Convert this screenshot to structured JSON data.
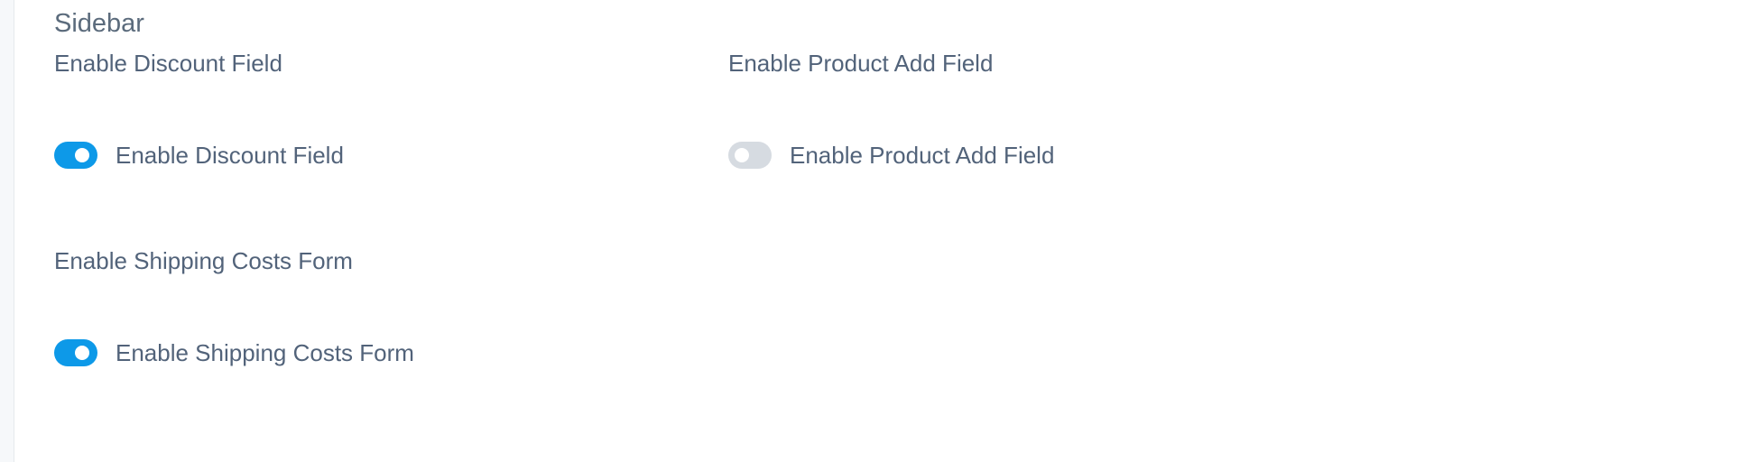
{
  "section": {
    "title": "Sidebar"
  },
  "fields": {
    "discount": {
      "label": "Enable Discount Field",
      "toggle_label": "Enable Discount Field",
      "enabled": true
    },
    "product_add": {
      "label": "Enable Product Add Field",
      "toggle_label": "Enable Product Add Field",
      "enabled": false
    },
    "shipping": {
      "label": "Enable Shipping Costs Form",
      "toggle_label": "Enable Shipping Costs Form",
      "enabled": true
    }
  },
  "colors": {
    "toggle_on": "#0d99e8",
    "toggle_off": "#d6dbe1",
    "text": "#52637a"
  }
}
